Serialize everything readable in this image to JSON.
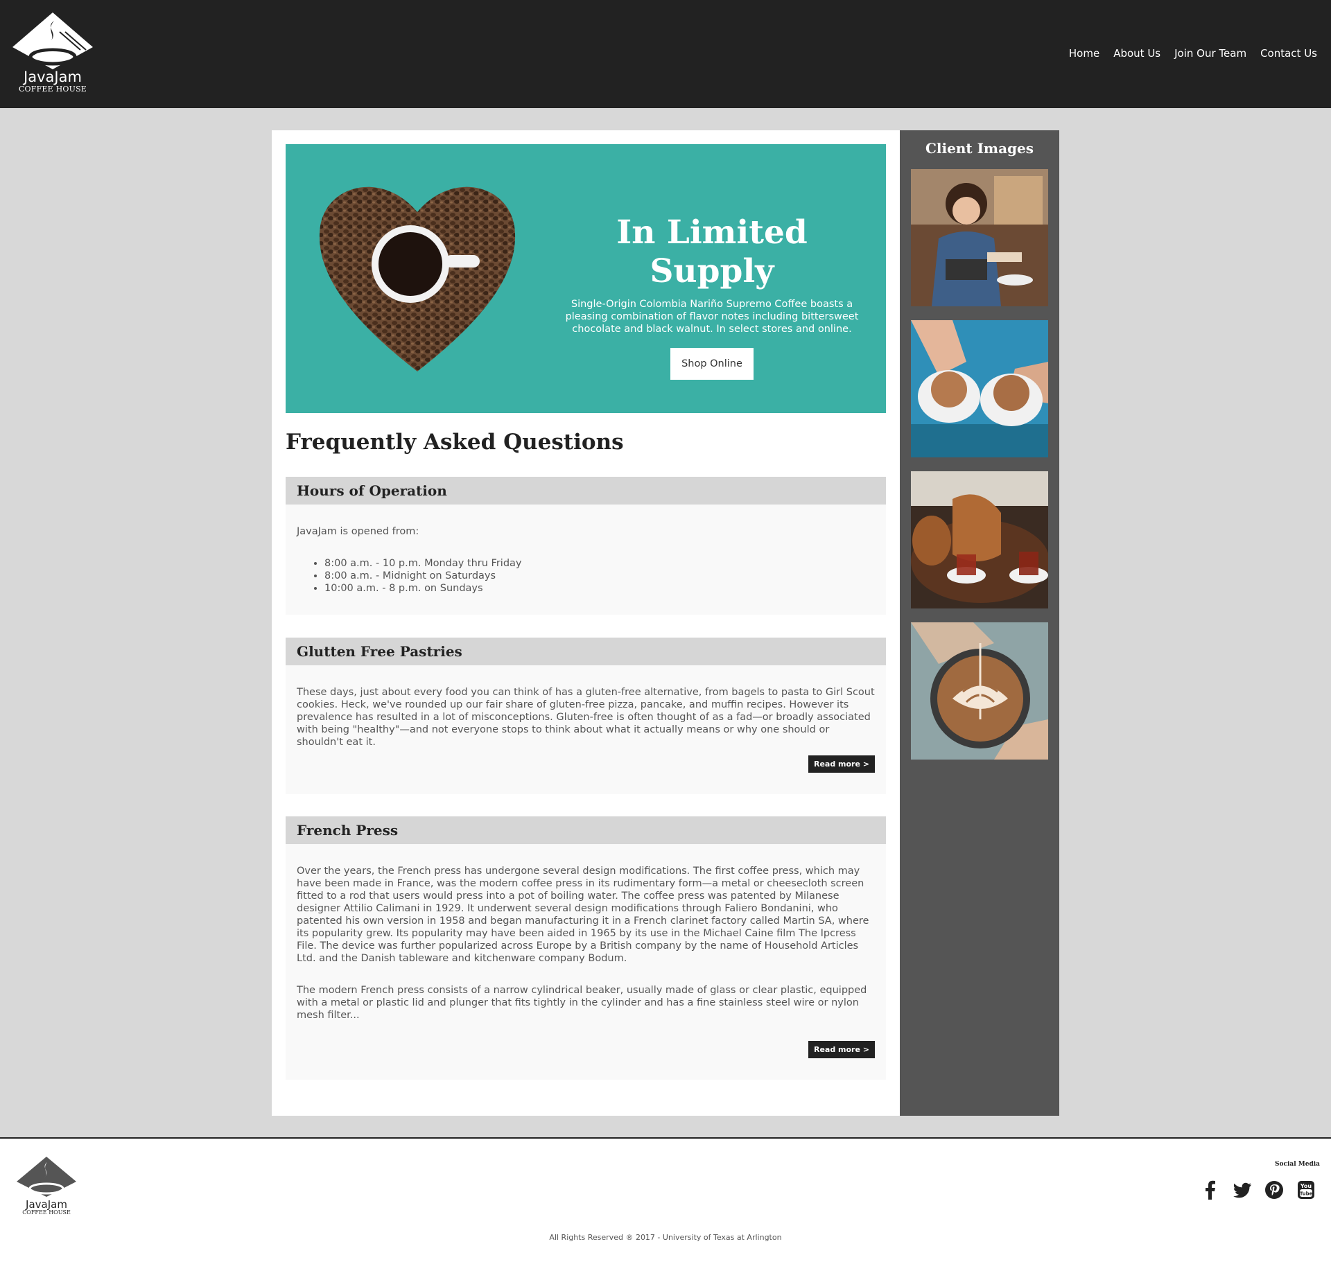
{
  "brand": {
    "name": "JavaJam",
    "subtitle": "COFFEE HOUSE"
  },
  "nav": {
    "items": [
      "Home",
      "About Us",
      "Join Our Team",
      "Contact Us"
    ]
  },
  "hero": {
    "title": "In Limited Supply",
    "description": "Single-Origin Colombia Nariño Supremo Coffee boasts a pleasing combination of flavor notes including bittersweet chocolate and black walnut. In select stores and online.",
    "button": "Shop Online",
    "background": "#3bb0a5"
  },
  "faq": {
    "title": "Frequently Asked Questions",
    "items": [
      {
        "heading": "Hours of Operation",
        "intro": "JavaJam is opened from:",
        "list": [
          "8:00 a.m. - 10 p.m. Monday thru Friday",
          "8:00 a.m. - Midnight on Saturdays",
          "10:00 a.m. - 8 p.m. on Sundays"
        ]
      },
      {
        "heading": "Glutten Free Pastries",
        "paragraphs": [
          "These days, just about every food you can think of has a gluten-free alternative, from bagels to pasta to Girl Scout cookies. Heck, we've rounded up our fair share of gluten-free pizza, pancake, and muffin recipes. However its prevalence has resulted in a lot of misconceptions. Gluten-free is often thought of as a fad—or broadly associated with being \"healthy\"—and not everyone stops to think about what it actually means or why one should or shouldn't eat it."
        ],
        "button": "Read more >"
      },
      {
        "heading": "French Press",
        "paragraphs": [
          "Over the years, the French press has undergone several design modifications. The first coffee press, which may have been made in France, was the modern coffee press in its rudimentary form—a metal or cheesecloth screen fitted to a rod that users would press into a pot of boiling water. The coffee press was patented by Milanese designer Attilio Calimani in 1929. It underwent several design modifications through Faliero Bondanini, who patented his own version in 1958 and began manufacturing it in a French clarinet factory called Martin SA, where its popularity grew. Its popularity may have been aided in 1965 by its use in the Michael Caine film The Ipcress File. The device was further popularized across Europe by a British company by the name of Household Articles Ltd. and the Danish tableware and kitchenware company Bodum.",
          "The modern French press consists of a narrow cylindrical beaker, usually made of glass or clear plastic, equipped with a metal or plastic lid and plunger that fits tightly in the cylinder and has a fine stainless steel wire or nylon mesh filter..."
        ],
        "button": "Read more >"
      }
    ]
  },
  "sidebar": {
    "title": "Client Images",
    "images": [
      "woman-paying-card",
      "two-cappuccinos",
      "turkish-tea-set",
      "latte-art"
    ]
  },
  "footer": {
    "social_label": "Social Media",
    "social_icons": [
      "facebook-icon",
      "twitter-icon",
      "pinterest-icon",
      "youtube-icon"
    ],
    "copyright": "All Rights Reserved ® 2017 - University of Texas at Arlington"
  }
}
